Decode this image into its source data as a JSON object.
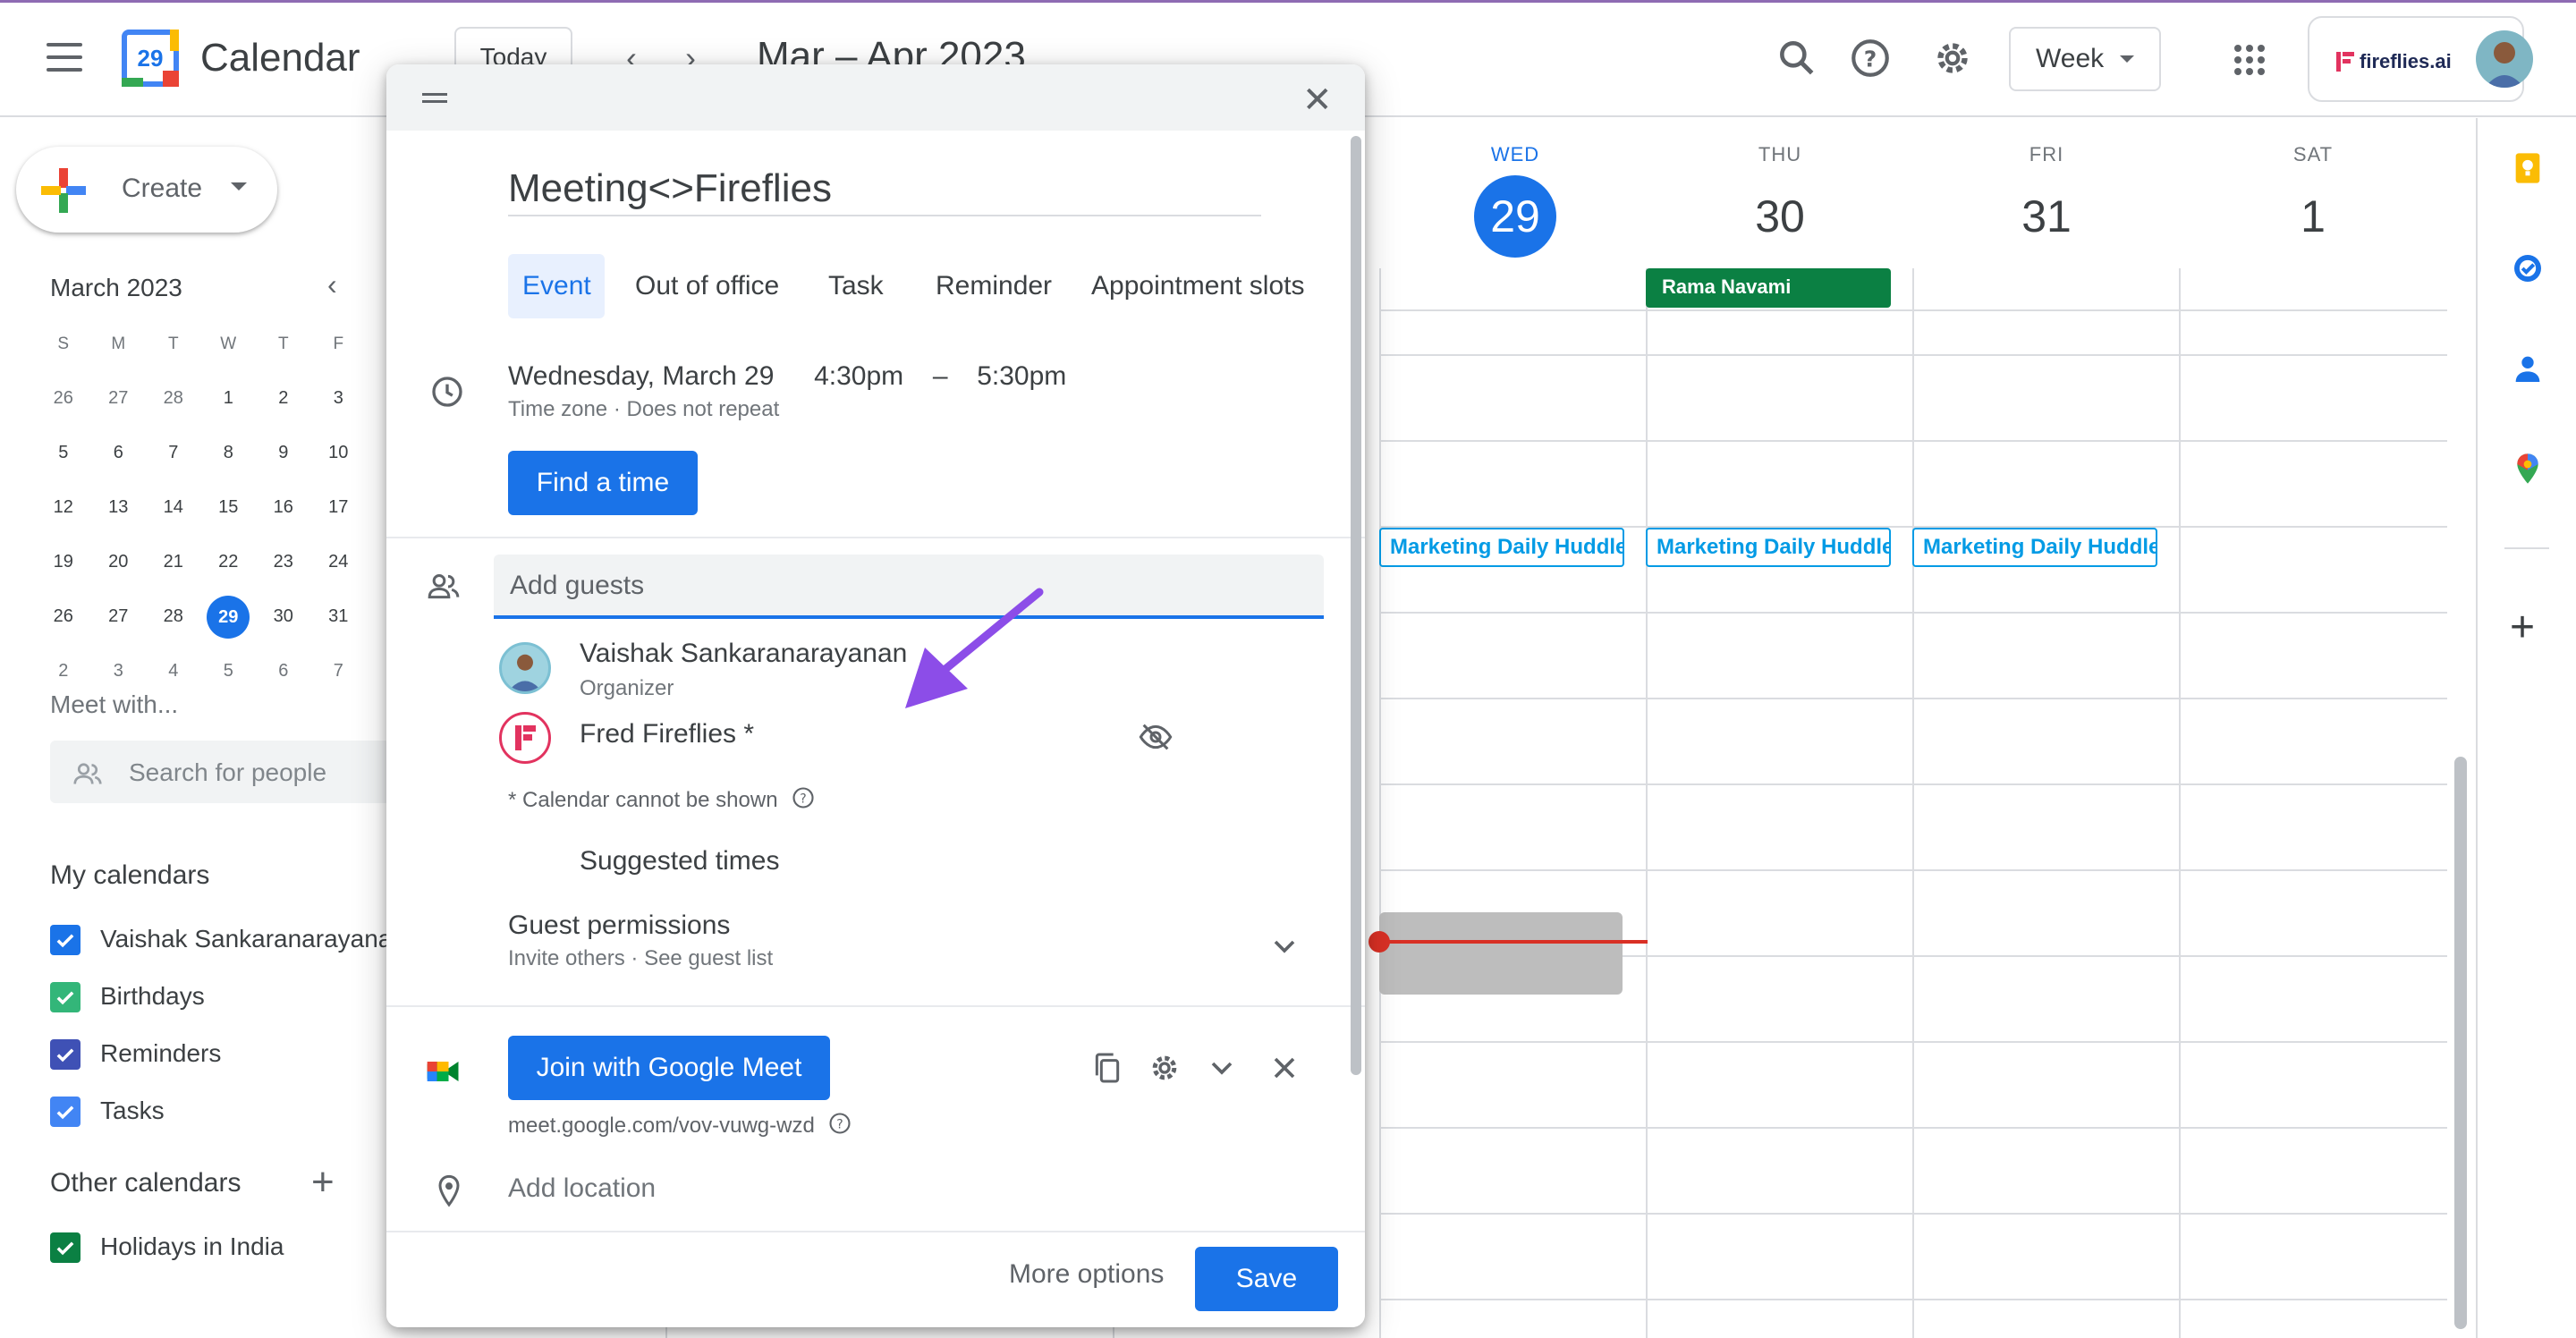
{
  "header": {
    "app_title": "Calendar",
    "logo_day": "29",
    "today_label": "Today",
    "date_range": "Mar – Apr 2023",
    "view_label": "Week",
    "brand_label": "fireflies.ai"
  },
  "sidebar": {
    "create_label": "Create",
    "mini_month": "March 2023",
    "weekday_headers": [
      "S",
      "M",
      "T",
      "W",
      "T",
      "F"
    ],
    "mini_weeks": [
      [
        "26",
        "27",
        "28",
        "1",
        "2",
        "3"
      ],
      [
        "5",
        "6",
        "7",
        "8",
        "9",
        "10"
      ],
      [
        "12",
        "13",
        "14",
        "15",
        "16",
        "17"
      ],
      [
        "19",
        "20",
        "21",
        "22",
        "23",
        "24"
      ],
      [
        "26",
        "27",
        "28",
        "29",
        "30",
        "31"
      ],
      [
        "2",
        "3",
        "4",
        "5",
        "6",
        "7"
      ]
    ],
    "meet_with": "Meet with...",
    "search_people": "Search for people",
    "my_calendars_title": "My calendars",
    "my_calendars": [
      {
        "label": "Vaishak Sankaranarayanan",
        "color": "#1a73e8"
      },
      {
        "label": "Birthdays",
        "color": "#33b679"
      },
      {
        "label": "Reminders",
        "color": "#3f51b5"
      },
      {
        "label": "Tasks",
        "color": "#4285f4"
      }
    ],
    "other_calendars_title": "Other calendars",
    "other_calendars": [
      {
        "label": "Holidays in India",
        "color": "#0b8043"
      }
    ]
  },
  "grid": {
    "days": [
      {
        "name": "WED",
        "num": "29"
      },
      {
        "name": "THU",
        "num": "30"
      },
      {
        "name": "FRI",
        "num": "31"
      },
      {
        "name": "SAT",
        "num": "1"
      }
    ],
    "allday_event": "Rama Navami",
    "huddle_label": "Marketing Daily Huddle"
  },
  "dialog": {
    "title": "Meeting<>Fireflies",
    "tabs": [
      "Event",
      "Out of office",
      "Task",
      "Reminder",
      "Appointment slots"
    ],
    "date": "Wednesday, March 29",
    "time_start": "4:30pm",
    "time_sep": "–",
    "time_end": "5:30pm",
    "tz_line": "Time zone · Does not repeat",
    "find_time": "Find a time",
    "add_guests_placeholder": "Add guests",
    "guests": [
      {
        "name": "Vaishak Sankaranarayanan",
        "role": "Organizer"
      },
      {
        "name": "Fred Fireflies *",
        "role": ""
      }
    ],
    "calendar_note": "* Calendar cannot be shown",
    "suggested_times": "Suggested times",
    "guest_permissions": "Guest permissions",
    "guest_permissions_sub": "Invite others · See guest list",
    "join_meet": "Join with Google Meet",
    "meet_link": "meet.google.com/vov-vuwg-wzd",
    "add_location": "Add location",
    "more_options": "More options",
    "save": "Save"
  },
  "colors": {
    "accent": "#1a73e8",
    "holiday_green": "#0b8043",
    "huddle_blue": "#039be5",
    "now_red": "#d93025",
    "annotation_arrow": "#8c4de8"
  }
}
